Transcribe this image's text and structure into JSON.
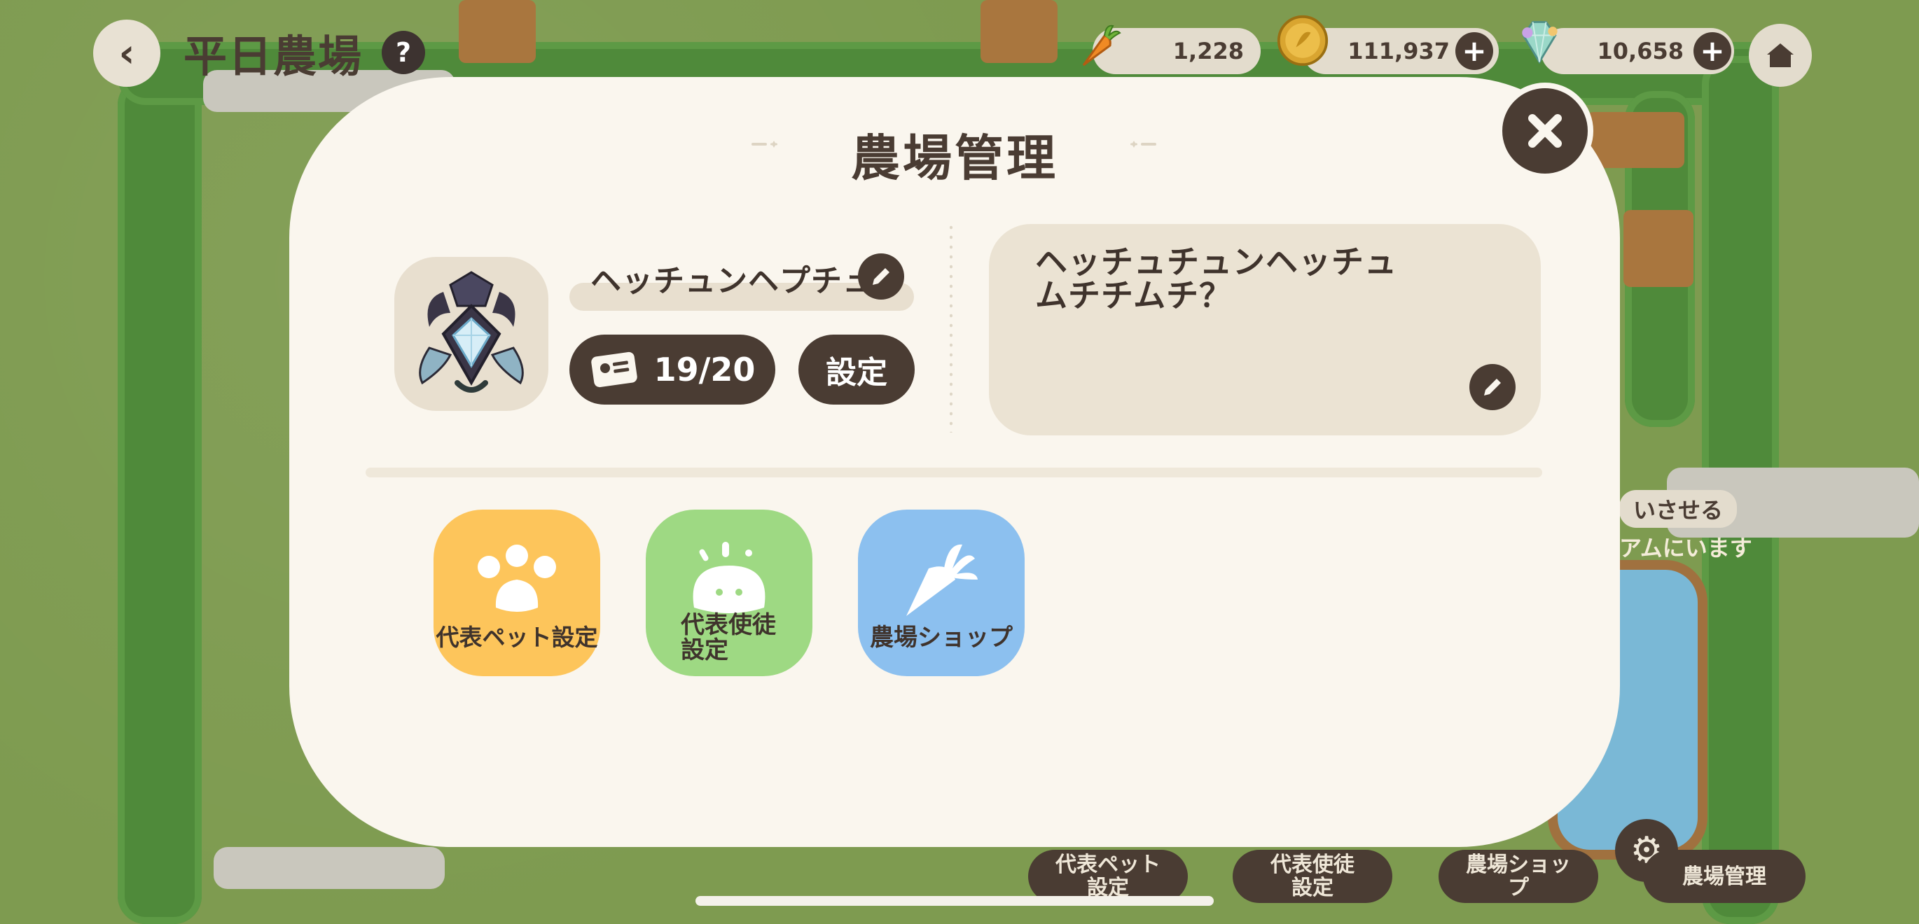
{
  "header": {
    "title": "平日農場",
    "help_icon": "?"
  },
  "resources": {
    "carrot": "1,228",
    "coin": "111,937",
    "crystal": "10,658"
  },
  "modal": {
    "title": "農場管理",
    "farm_name": "ヘッチュンヘプチュ",
    "count": "19/20",
    "settings_label": "設定",
    "comment": "ヘッチュチュンヘッチュムチチムチ？",
    "menu": [
      {
        "label": "代表ペット設定",
        "color": "#fdc55b"
      },
      {
        "label": "代表使徒\n設定",
        "color": "#9ed983"
      },
      {
        "label": "農場ショップ",
        "color": "#8cc0ef"
      }
    ]
  },
  "background_ui": {
    "bottom_buttons": [
      "代表ペット\n設定",
      "代表使徒\n設定",
      "農場ショッ\nプ",
      "農場管理"
    ],
    "snippet_1": "いさせる",
    "snippet_2": "アムにいます"
  },
  "colors": {
    "dark_brown": "#4a3c33",
    "modal_bg": "#faf6ee",
    "field_bg": "#ebe3d3"
  }
}
